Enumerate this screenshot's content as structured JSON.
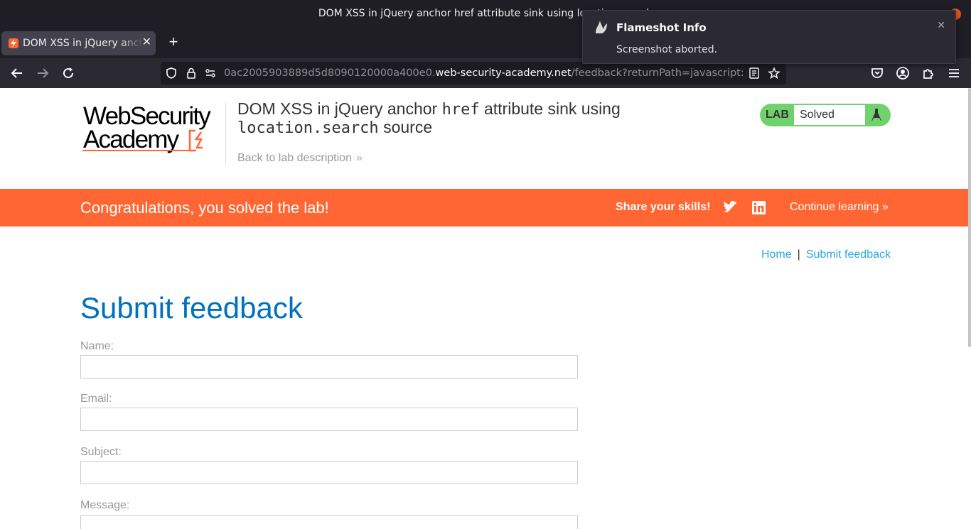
{
  "window": {
    "title": "DOM XSS in jQuery anchor href attribute sink using location.search"
  },
  "tabs": [
    {
      "label": "DOM XSS in jQuery anchor href attribute sink using location.search"
    }
  ],
  "url": {
    "prefix": "0ac2005903889d5d8090120000a400e0.",
    "host": "web-security-academy.net",
    "path": "/feedback?returnPath=javascript:alert(document.domain)"
  },
  "notification": {
    "title": "Flameshot Info",
    "body": "Screenshot aborted."
  },
  "logo": {
    "line1": "WebSecurity",
    "line2": "Academy"
  },
  "lab": {
    "title_part1": "DOM XSS in jQuery anchor ",
    "title_code1": "href",
    "title_part2": " attribute sink using ",
    "title_code2": "location.search",
    "title_part3": " source",
    "back_link": "Back to lab description",
    "badge_label": "LAB",
    "status": "Solved"
  },
  "banner": {
    "message": "Congratulations, you solved the lab!",
    "share_label": "Share your skills!",
    "continue_link": "Continue learning"
  },
  "breadcrumb": {
    "home": "Home",
    "separator": "|",
    "current": "Submit feedback"
  },
  "form": {
    "title": "Submit feedback",
    "fields": [
      {
        "label": "Name:",
        "value": ""
      },
      {
        "label": "Email:",
        "value": ""
      },
      {
        "label": "Subject:",
        "value": ""
      },
      {
        "label": "Message:",
        "value": ""
      }
    ]
  },
  "colors": {
    "brand_orange": "#ff6633",
    "lab_green": "#70d16d",
    "link_blue": "#29a8e0",
    "title_blue": "#0071bc"
  }
}
